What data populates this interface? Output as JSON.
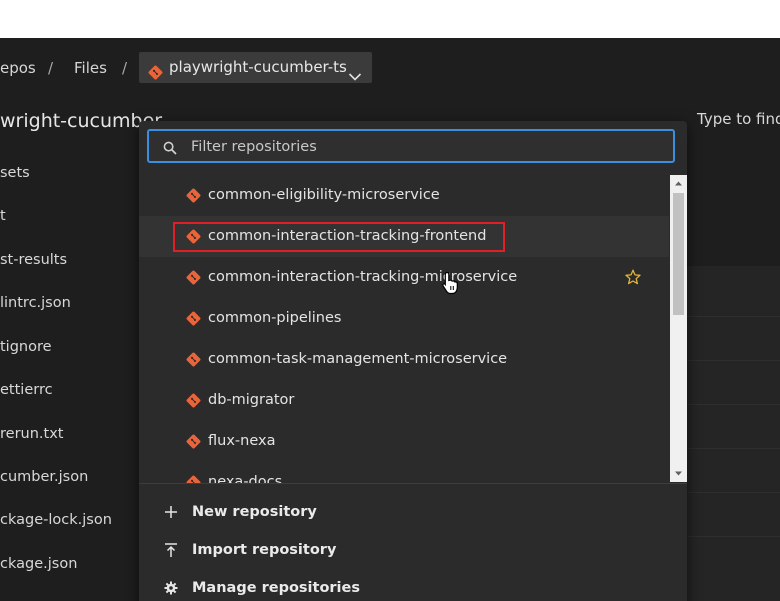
{
  "breadcrumb": {
    "repos": "epos",
    "sep": "/",
    "files": "Files",
    "current_repo": "playwright-cucumber-ts"
  },
  "sidebar": {
    "title": "wright-cucumber",
    "items": [
      "sets",
      "t",
      "st-results",
      "lintrc.json",
      "tignore",
      "ettierrc",
      "rerun.txt",
      "cumber.json",
      "ckage-lock.json",
      "ckage.json"
    ]
  },
  "right_panel": {
    "find_text": "Type to find"
  },
  "dropdown": {
    "filter_placeholder": "Filter repositories",
    "repositories": [
      "common-eligibility-microservice",
      "common-interaction-tracking-frontend",
      "common-interaction-tracking-microservice",
      "common-pipelines",
      "common-task-management-microservice",
      "db-migrator",
      "flux-nexa",
      "nexa-docs"
    ],
    "actions": {
      "new": "New repository",
      "import": "Import repository",
      "manage": "Manage repositories"
    }
  },
  "colors": {
    "git_orange": "#e8643b",
    "highlight_red": "#e01f26",
    "focus_blue": "#3a8fe0",
    "star_yellow": "#e0b53a"
  },
  "icons": [
    "git-repo-icon",
    "chevron-down-icon",
    "search-icon",
    "star-icon",
    "plus-icon",
    "import-icon",
    "gear-icon",
    "pointer-cursor-icon"
  ]
}
